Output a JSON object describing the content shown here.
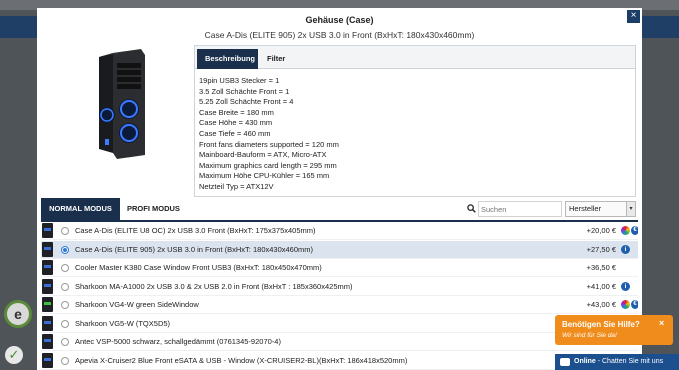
{
  "modal": {
    "title": "Gehäuse (Case)",
    "subtitle": "Case A-Dis (ELITE 905) 2x USB 3.0 in Front (BxHxT: 180x430x460mm)",
    "close_label": "×"
  },
  "tabs": [
    {
      "label": "Beschreibung",
      "active": true
    },
    {
      "label": "Filter",
      "active": false
    }
  ],
  "description_lines": [
    "19pin USB3 Stecker = 1",
    "3.5 Zoll Schächte Front = 1",
    "5.25 Zoll Schächte Front = 4",
    "Case Breite = 180 mm",
    "Case Höhe = 430 mm",
    "Case Tiefe = 460 mm",
    "Front fans diameters supported = 120 mm",
    "Mainboard-Bauform = ATX, Micro-ATX",
    "Maximum graphics card length = 295 mm",
    "Maximum Höhe CPU-Kühler = 165 mm",
    "Netzteil Typ = ATX12V"
  ],
  "toolbar": {
    "normal_mode": "NORMAL MODUS",
    "profi_mode": "PROFI MODUS",
    "search_placeholder": "Suchen",
    "sort_value": "Hersteller"
  },
  "products": [
    {
      "name": "Case A-Dis (ELITE U8 OC) 2x USB 3.0 Front (BxHxT: 175x375x405mm)",
      "price": "+20,00 €",
      "selected": false,
      "icons": [
        "color",
        "euro"
      ]
    },
    {
      "name": "Case A-Dis (ELITE 905) 2x USB 3.0 in Front (BxHxT: 180x430x460mm)",
      "price": "+27,50 €",
      "selected": true,
      "icons": [
        "info"
      ]
    },
    {
      "name": "Cooler Master K380 Case Window Front USB3 (BxHxT: 180x450x470mm)",
      "price": "+36,50 €",
      "selected": false,
      "icons": []
    },
    {
      "name": "Sharkoon MA-A1000 2x USB 3.0 & 2x USB 2.0 in Front (BxHxT : 185x360x425mm)",
      "price": "+41,00 €",
      "selected": false,
      "icons": [
        "info"
      ]
    },
    {
      "name": "Sharkoon VG4-W green SideWindow",
      "price": "+43,00 €",
      "selected": false,
      "icons": [
        "color",
        "euro"
      ]
    },
    {
      "name": "Sharkoon VG5-W (TQX5D5)",
      "price": "+46,00 €",
      "selected": false,
      "icons": [
        "color",
        "euro"
      ]
    },
    {
      "name": "Antec VSP-5000 schwarz, schallgedämmt (0761345-92070-4)",
      "price": "",
      "selected": false,
      "icons": []
    },
    {
      "name": "Apevia X-Cruiser2 Blue Front eSATA & USB - Window (X-CRUISER2-BL)(BxHxT: 186x418x520mm)",
      "price": "+46,50 €",
      "selected": false,
      "icons": []
    }
  ],
  "help": {
    "title": "Benötigen Sie Hilfe?",
    "subtitle": "Wir sind für Sie da!",
    "close": "×"
  },
  "chat": {
    "status": "Online",
    "text": " - Chatten Sie mit uns"
  },
  "colors": {
    "navy": "#1a2f4c",
    "selected_row": "#dbe4ee",
    "help_orange": "#f08c1b",
    "chat_blue": "#1c4f8e"
  }
}
